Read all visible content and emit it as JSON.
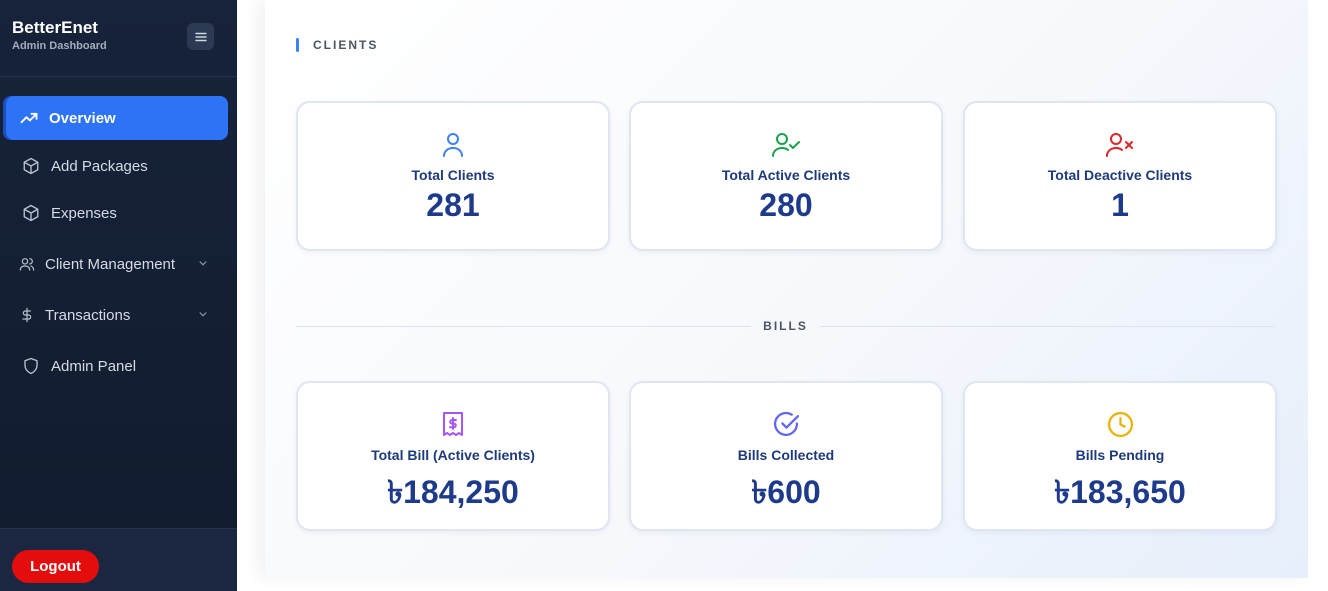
{
  "brand": {
    "title": "BetterEnet",
    "subtitle": "Admin Dashboard"
  },
  "sidebar": {
    "items": [
      {
        "label": "Overview",
        "icon": "trending-up-icon",
        "active": true
      },
      {
        "label": "Add Packages",
        "icon": "package-icon"
      },
      {
        "label": "Expenses",
        "icon": "package-icon"
      },
      {
        "label": "Client Management",
        "icon": "users-icon",
        "expandable": true
      },
      {
        "label": "Transactions",
        "icon": "dollar-icon",
        "expandable": true
      },
      {
        "label": "Admin Panel",
        "icon": "shield-icon"
      }
    ],
    "logout_label": "Logout"
  },
  "clients": {
    "section_label": "CLIENTS",
    "cards": [
      {
        "title": "Total Clients",
        "value": "281",
        "icon": "user-icon",
        "color": "#3b82f6"
      },
      {
        "title": "Total Active Clients",
        "value": "280",
        "icon": "user-check-icon",
        "color": "#16a34a"
      },
      {
        "title": "Total Deactive Clients",
        "value": "1",
        "icon": "user-x-icon",
        "color": "#dc2626"
      }
    ]
  },
  "bills": {
    "section_label": "BILLS",
    "cards": [
      {
        "title": "Total Bill (Active Clients)",
        "value": "৳184,250",
        "icon": "receipt-icon",
        "color": "#a855f7"
      },
      {
        "title": "Bills Collected",
        "value": "৳600",
        "icon": "check-circle-icon",
        "color": "#6366f1"
      },
      {
        "title": "Bills Pending",
        "value": "৳183,650",
        "icon": "clock-icon",
        "color": "#eab308"
      }
    ]
  }
}
